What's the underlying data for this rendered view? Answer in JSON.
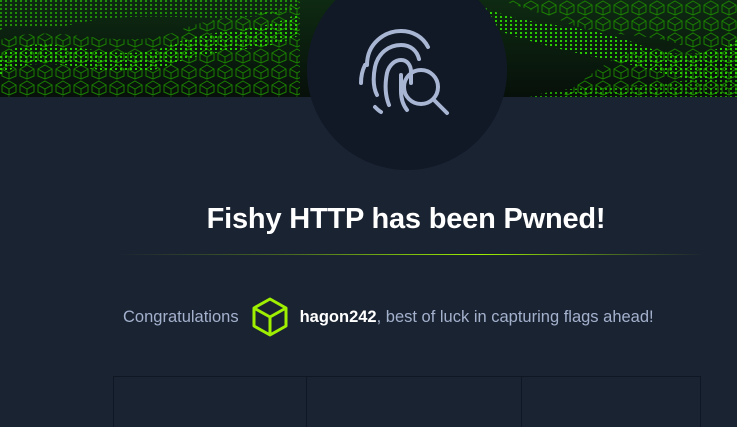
{
  "header": {
    "banner": "green-cube-wave-banner",
    "avatar_icon": "fingerprint-search-icon",
    "accent_color": "#9fef00"
  },
  "main": {
    "title": "Fishy HTTP has been Pwned!",
    "congrats_prefix": "Congratulations",
    "user_badge_icon": "cube-icon",
    "username": "hagon242",
    "congrats_suffix": ", best of luck in capturing flags ahead!"
  },
  "colors": {
    "background": "#1a2332",
    "avatar_bg": "#111927",
    "text_muted": "#a4b1cd",
    "title": "#ffffff"
  }
}
